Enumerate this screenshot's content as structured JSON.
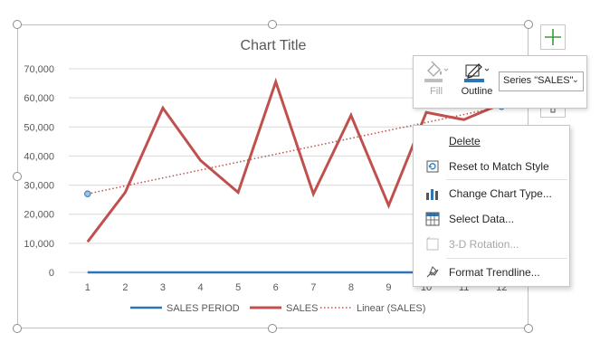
{
  "chart_data": {
    "type": "line",
    "title": "Chart Title",
    "categories": [
      "1",
      "2",
      "3",
      "4",
      "5",
      "6",
      "7",
      "8",
      "9",
      "10",
      "11",
      "12"
    ],
    "ylim": [
      0,
      70000
    ],
    "y_ticks": [
      "0",
      "10,000",
      "20,000",
      "30,000",
      "40,000",
      "50,000",
      "60,000",
      "70,000"
    ],
    "grid": true,
    "legend_position": "bottom",
    "series": [
      {
        "name": "SALES PERIOD",
        "color": "#2e75b6",
        "values": [
          1,
          2,
          3,
          4,
          5,
          6,
          7,
          8,
          9,
          10,
          11,
          12
        ]
      },
      {
        "name": "SALES",
        "color": "#c0504d",
        "values": [
          10500,
          27500,
          56500,
          38500,
          27500,
          65500,
          27000,
          54000,
          23000,
          55000,
          52500,
          58000
        ]
      }
    ],
    "trendline": {
      "name": "Linear (SALES)",
      "color": "#c0504d",
      "style": "dotted",
      "start": [
        1,
        27000
      ],
      "end": [
        12,
        57000
      ]
    }
  },
  "side_buttons": [
    {
      "icon": "plus-icon"
    },
    {
      "icon": "paintbrush-icon"
    }
  ],
  "mini_toolbar": {
    "fill_label": "Fill",
    "outline_label": "Outline",
    "series_select_value": "Series \"SALES\"",
    "fill_disabled": true
  },
  "context_menu": {
    "items": [
      {
        "label": "Delete",
        "underline": "D",
        "icon": "none",
        "disabled": false
      },
      {
        "label": "Reset to Match Style",
        "underline": "a",
        "icon": "reset-style-icon",
        "disabled": false
      },
      {
        "label": "Change Chart Type...",
        "underline": "Y",
        "icon": "change-chart-type-icon",
        "disabled": false
      },
      {
        "label": "Select Data...",
        "underline": "E",
        "icon": "select-data-icon",
        "disabled": false
      },
      {
        "label": "3-D Rotation...",
        "underline": "R",
        "icon": "3d-rotation-icon",
        "disabled": true
      },
      {
        "label": "Format Trendline...",
        "underline": "F",
        "icon": "format-trendline-icon",
        "disabled": false
      }
    ]
  },
  "colors": {
    "accent_blue": "#2e75b6",
    "series_red": "#c0504d",
    "gridline": "#d9d9d9",
    "border": "#c6c6c6"
  }
}
